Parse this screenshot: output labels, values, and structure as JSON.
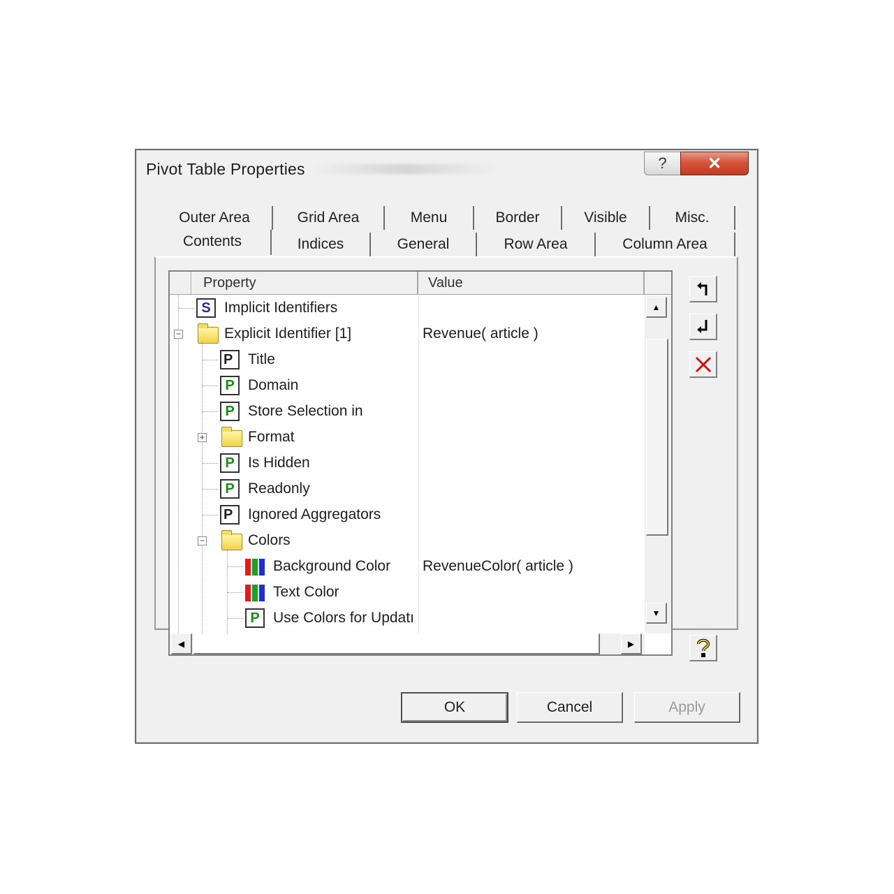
{
  "window": {
    "title": "Pivot Table Properties",
    "help_glyph": "?",
    "close_glyph": "✕"
  },
  "tabs": {
    "row1": [
      "Outer Area",
      "Grid Area",
      "Menu",
      "Border",
      "Visible",
      "Misc."
    ],
    "row2": [
      "Contents",
      "Indices",
      "General",
      "Row Area",
      "Column Area"
    ],
    "selected": "Contents"
  },
  "grid": {
    "headers": {
      "property": "Property",
      "value": "Value"
    },
    "rows": [
      {
        "label": "Implicit Identifiers",
        "value": "",
        "icon": "s-icon",
        "level": 0
      },
      {
        "label": "Explicit Identifier [1]",
        "value": "Revenue( article )",
        "icon": "open-folder-icon",
        "level": 0,
        "expanded": true
      },
      {
        "label": "Title",
        "value": "",
        "icon": "p-string-icon",
        "level": 1
      },
      {
        "label": "Domain",
        "value": "",
        "icon": "p-icon",
        "level": 1
      },
      {
        "label": "Store Selection in",
        "value": "",
        "icon": "p-icon",
        "level": 1
      },
      {
        "label": "Format",
        "value": "",
        "icon": "folder-icon",
        "level": 1,
        "expanded": false
      },
      {
        "label": "Is Hidden",
        "value": "",
        "icon": "p-icon",
        "level": 1
      },
      {
        "label": "Readonly",
        "value": "",
        "icon": "p-icon",
        "level": 1
      },
      {
        "label": "Ignored Aggregators",
        "value": "",
        "icon": "p-string-icon",
        "level": 1
      },
      {
        "label": "Colors",
        "value": "",
        "icon": "open-folder-icon",
        "level": 1,
        "expanded": true
      },
      {
        "label": "Background Color",
        "value": "RevenueColor( article )",
        "icon": "color-icon",
        "level": 2
      },
      {
        "label": "Text Color",
        "value": "",
        "icon": "color-icon",
        "level": 2
      },
      {
        "label": "Use Colors for Updatı",
        "value": "",
        "icon": "p-icon",
        "level": 2
      }
    ]
  },
  "side_buttons": [
    "undo-icon",
    "redo-icon",
    "delete-icon",
    "help-icon"
  ],
  "buttons": {
    "ok": "OK",
    "cancel": "Cancel",
    "apply": "Apply"
  },
  "colors": {
    "close_red": "#c8442a",
    "p_green": "#1a8a1a",
    "s_blue": "#2a2aa8"
  }
}
